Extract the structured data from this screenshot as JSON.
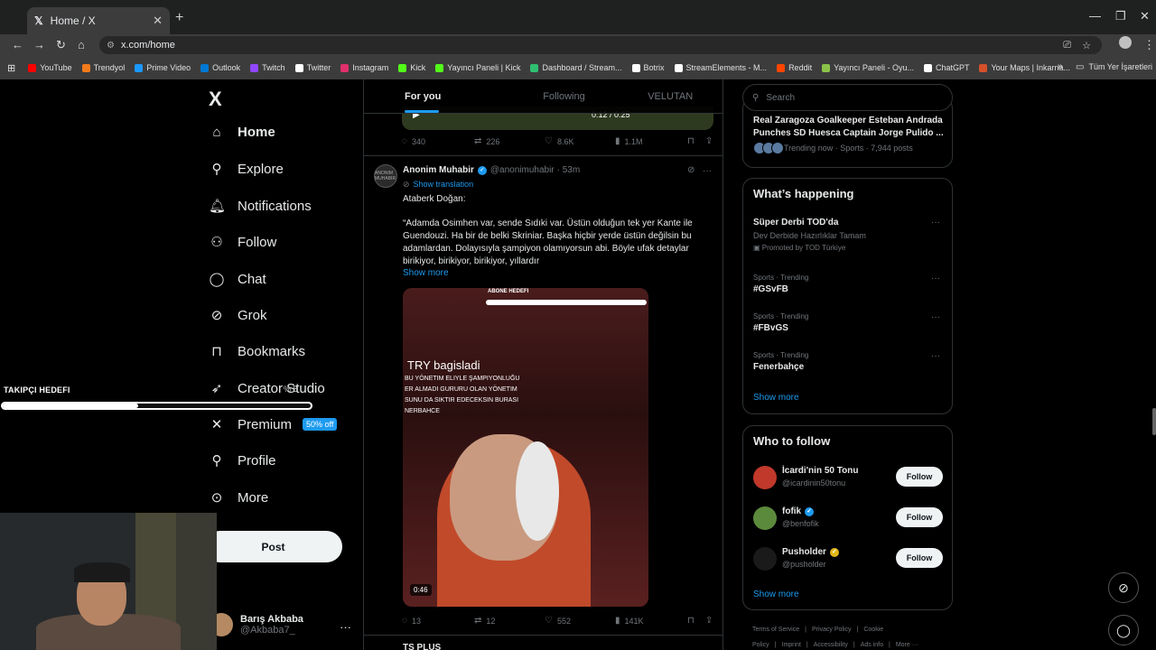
{
  "browser": {
    "tab_title": "Home / X",
    "tab_icon": "x-logo-icon",
    "url": "x.com/home",
    "bookmarks": [
      {
        "label": "YouTube",
        "color": "#ff0000"
      },
      {
        "label": "Trendyol",
        "color": "#f27a1a"
      },
      {
        "label": "Prime Video",
        "color": "#1a98ff"
      },
      {
        "label": "Outlook",
        "color": "#0078d4"
      },
      {
        "label": "Twitch",
        "color": "#9146ff"
      },
      {
        "label": "Twitter",
        "color": "#ffffff"
      },
      {
        "label": "Instagram",
        "color": "#e1306c"
      },
      {
        "label": "Kick",
        "color": "#53fc18"
      },
      {
        "label": "Yayıncı Paneli | Kick",
        "color": "#53fc18"
      },
      {
        "label": "Dashboard / Stream...",
        "color": "#2fbf71"
      },
      {
        "label": "Botrix",
        "color": "#ffffff"
      },
      {
        "label": "StreamElements - M...",
        "color": "#ffffff"
      },
      {
        "label": "Reddit",
        "color": "#ff4500"
      },
      {
        "label": "Yayıncı Paneli - Oyu...",
        "color": "#8bc34a"
      },
      {
        "label": "ChatGPT",
        "color": "#ffffff"
      },
      {
        "label": "Your Maps | Inkarna...",
        "color": "#d4502a"
      }
    ],
    "all_bookmarks": "Tüm Yer İşaretleri"
  },
  "sidebar": {
    "logo": "X",
    "items": [
      {
        "label": "Home",
        "icon": "home-icon",
        "glyph": "⌂"
      },
      {
        "label": "Explore",
        "icon": "search-icon",
        "glyph": "⚲"
      },
      {
        "label": "Notifications",
        "icon": "bell-icon",
        "glyph": "🔔︎"
      },
      {
        "label": "Follow",
        "icon": "person-plus-icon",
        "glyph": "⚇"
      },
      {
        "label": "Chat",
        "icon": "chat-icon",
        "glyph": "◯"
      },
      {
        "label": "Grok",
        "icon": "grok-icon",
        "glyph": "⊘"
      },
      {
        "label": "Bookmarks",
        "icon": "bookmark-icon",
        "glyph": "⊓"
      },
      {
        "label": "Creator Studio",
        "icon": "rocket-icon",
        "glyph": "➶"
      },
      {
        "label": "Premium",
        "icon": "x-icon",
        "glyph": "✕"
      },
      {
        "label": "Profile",
        "icon": "person-icon",
        "glyph": "⚲"
      },
      {
        "label": "More",
        "icon": "more-circle-icon",
        "glyph": "⊙"
      }
    ],
    "premium_badge": "50% off",
    "post_label": "Post",
    "account": {
      "name": "Barış Akbaba",
      "handle": "@Akbaba7_"
    }
  },
  "overlay": {
    "label": "TAKIPÇI HEDEFI",
    "tail": "% 8",
    "progress": 0.44
  },
  "feed": {
    "tabs": [
      "For you",
      "Following",
      "VELUTAN"
    ],
    "prev_tweet": {
      "time": "0:12 / 0:25",
      "replies": "340",
      "reposts": "226",
      "likes": "8.6K",
      "views": "1.1M"
    },
    "tweet": {
      "name": "Anonim Muhabir",
      "handle": "@anonimuhabir",
      "time": "· 53m",
      "avatar_text": "ANONIM MUHABIR",
      "translation": "Show translation",
      "line1": "Ataberk Doğan:",
      "body": "“Adamda Osimhen var, sende Sıdıki var. Üstün olduğun tek yer Kante ile Guendouzi. Ha bir de belki Skriniar. Başka hiçbir yerde üstün değilsin bu adamlardan. Dolayısıyla şampiyon olamıyorsun abi. Böyle ufak detaylar birikiyor, birikiyor, birikiyor, yıllardır",
      "show_more": "Show more",
      "media": {
        "goal_label": "ABONE HEDEFI",
        "donation": "TRY bagisladi",
        "caption": "BU YÖNETIM ELIYLE ŞAMPIYONLUĞU\nER ALMADI GURURU OLAN YÖNETIM\nSUNU DA SIKTIR EDECEKSIN BURASI\nNERBAHCE",
        "duration": "0:46"
      },
      "replies": "13",
      "reposts": "12",
      "likes": "552",
      "views": "141K"
    },
    "next_tweet_name": "TS PLUS"
  },
  "right": {
    "search_placeholder": "Search",
    "trend_now": {
      "title": "Real Zaragoza Goalkeeper Esteban Andrada Punches SD Huesca Captain Jorge Pulido ...",
      "meta": "Trending now · Sports · 7,944 posts"
    },
    "happening": {
      "title": "What’s happening",
      "items": [
        {
          "sub": "",
          "name": "Süper Derbi TOD'da",
          "desc": "Dev Derbide Hazırlıklar Tamam",
          "promo": "Promoted by TOD Türkiye"
        },
        {
          "sub": "Sports · Trending",
          "name": "#GSvFB"
        },
        {
          "sub": "Sports · Trending",
          "name": "#FBvGS"
        },
        {
          "sub": "Sports · Trending",
          "name": "Fenerbahçe"
        }
      ],
      "show_more": "Show more"
    },
    "who_to_follow": {
      "title": "Who to follow",
      "items": [
        {
          "name": "İcardi'nin 50 Tonu",
          "handle": "@icardinin50tonu",
          "badge": "",
          "color": "#c0392b"
        },
        {
          "name": "fofik",
          "handle": "@benfofik",
          "badge": "blue",
          "color": "#5c8a3c"
        },
        {
          "name": "Pusholder",
          "handle": "@pusholder",
          "badge": "gold",
          "color": "#1a1a1a"
        }
      ],
      "follow_label": "Follow",
      "show_more": "Show more"
    },
    "footer": [
      "Terms of Service",
      "|",
      "Privacy Policy",
      "|",
      "Cookie Policy",
      "|",
      "Imprint",
      "|",
      "Accessibility",
      "|",
      "Ads info",
      "|",
      "More ···"
    ]
  }
}
